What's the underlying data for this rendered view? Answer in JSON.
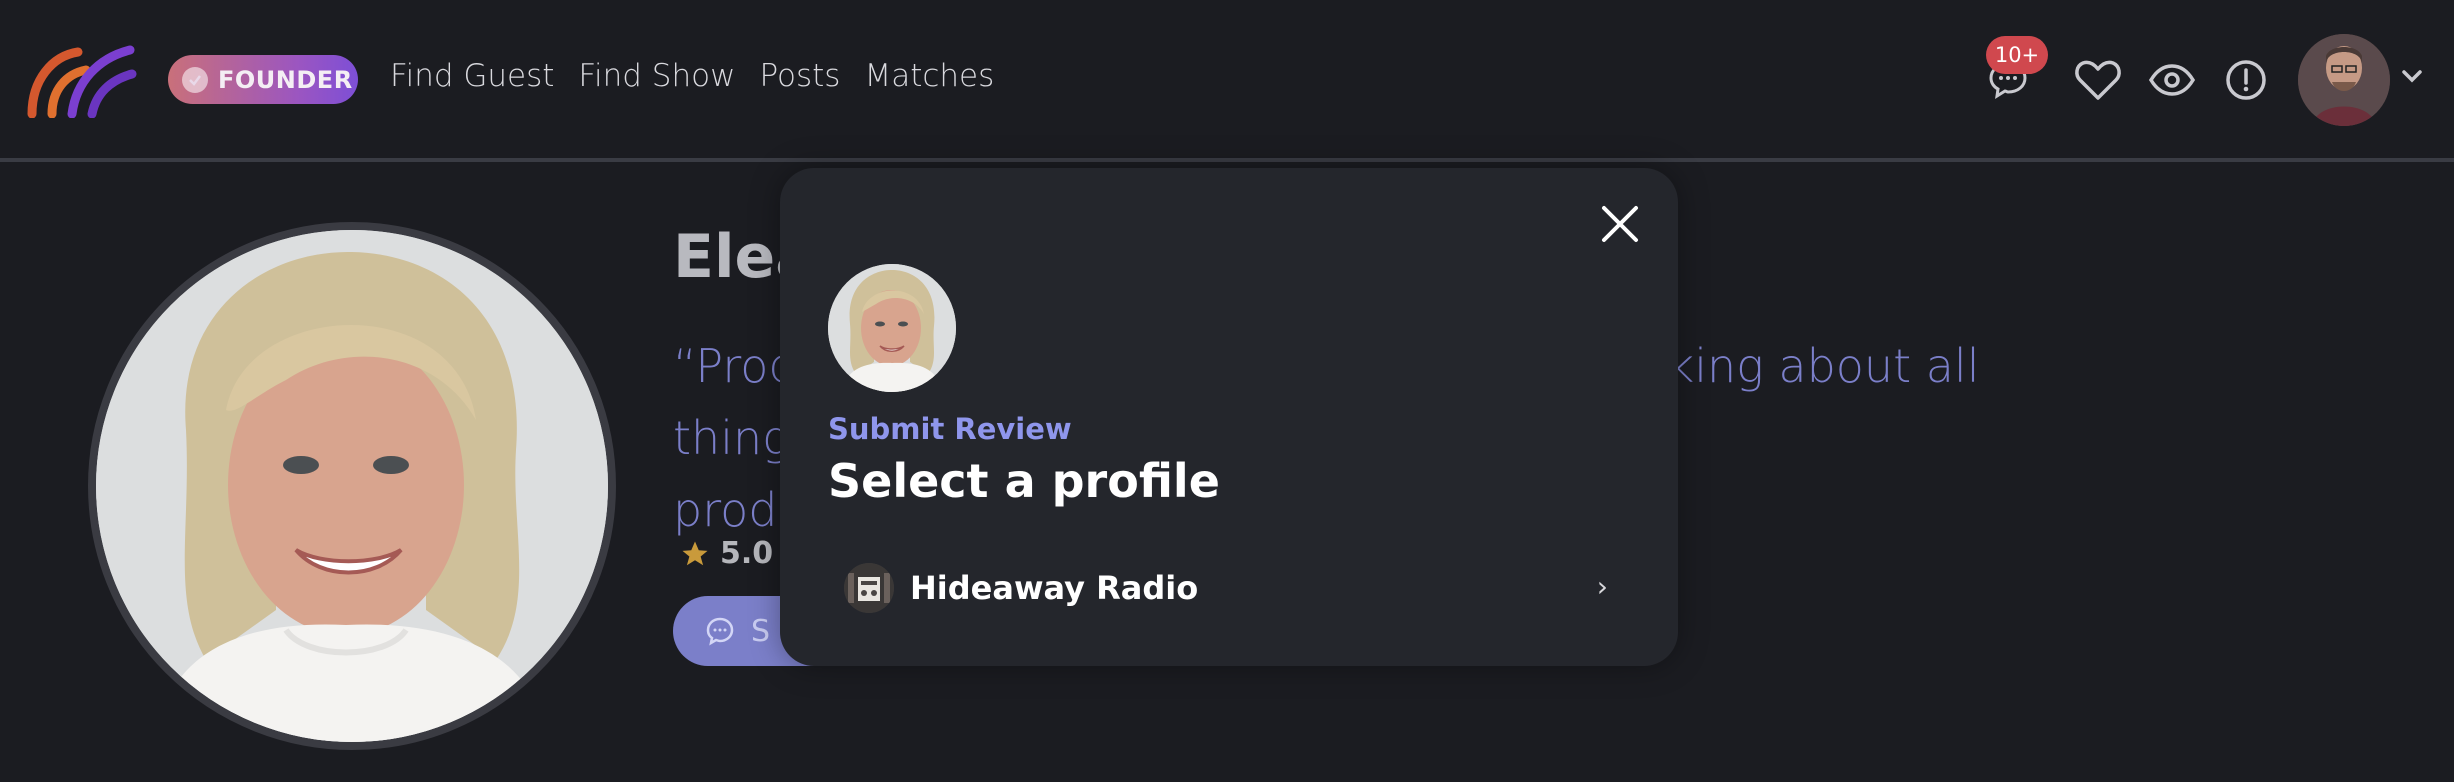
{
  "header": {
    "badge_label": "FOUNDER",
    "nav": [
      {
        "label": "Find Guest"
      },
      {
        "label": "Find Show"
      },
      {
        "label": "Posts"
      },
      {
        "label": "Matches"
      }
    ],
    "messages_badge": "10+",
    "icons": [
      "logo-icon",
      "check-icon",
      "messages-icon",
      "heart-icon",
      "eye-icon",
      "alert-icon",
      "chevron-down-icon"
    ]
  },
  "profile": {
    "name": "Elea",
    "quote_line1": "“Prod",
    "quote_line1_end": "king about all things",
    "quote_line2": "prod",
    "rating": "5.0",
    "rating_sep": "/",
    "send_button_label": "S"
  },
  "modal": {
    "eyebrow": "Submit Review",
    "title": "Select a profile",
    "options": [
      {
        "label": "Hideaway Radio"
      }
    ],
    "colors": {
      "accent": "#8f96ec",
      "background": "#24262c"
    }
  }
}
